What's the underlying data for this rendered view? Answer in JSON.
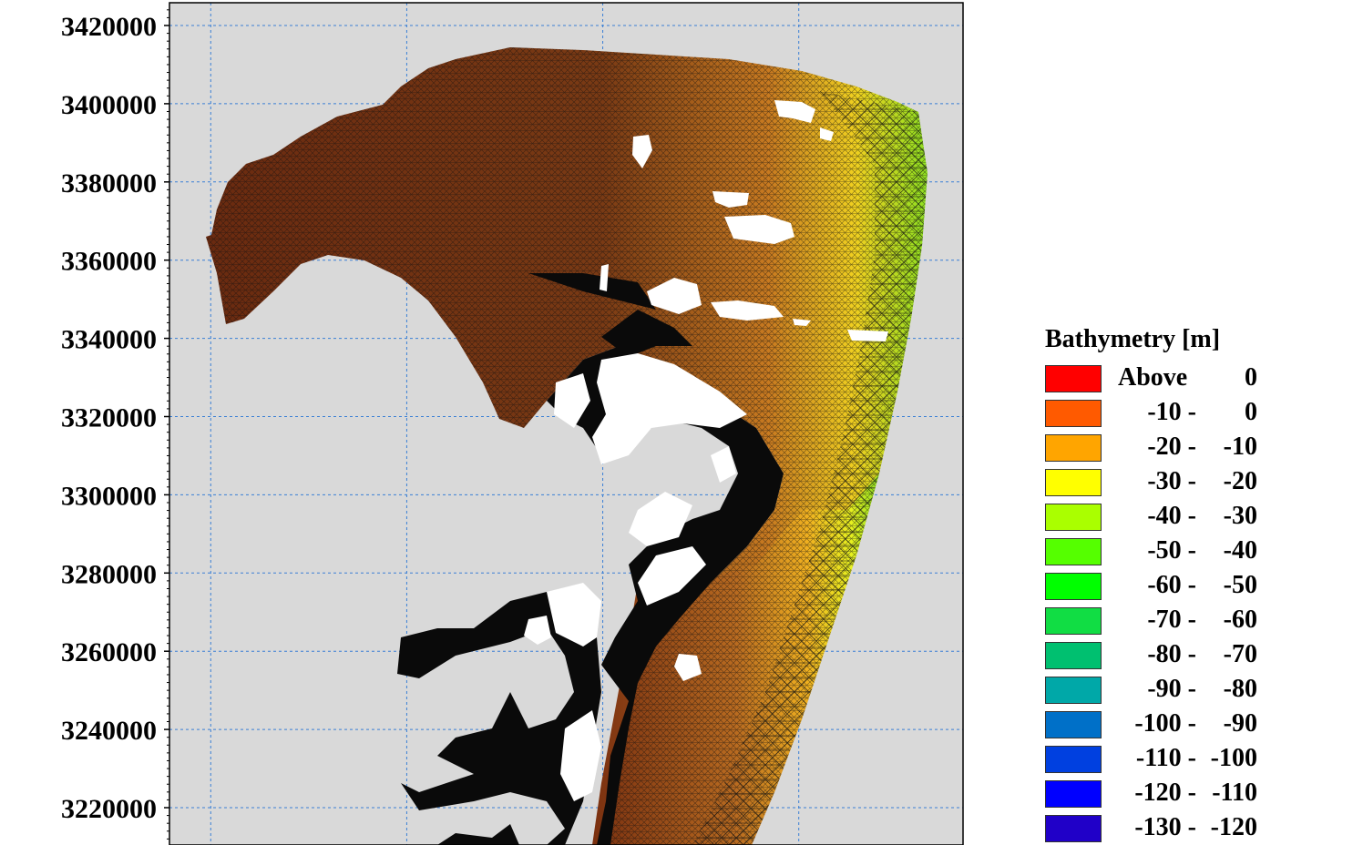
{
  "map": {
    "background_color": "#d9d9d9",
    "grid_color": "#3a7fd5",
    "mesh_line_color": "#111111",
    "land_color": "#ffffff",
    "y_range": [
      3208000,
      3426000
    ],
    "y_ticks": [
      {
        "value": 3420000,
        "label": "3420000"
      },
      {
        "value": 3400000,
        "label": "3400000"
      },
      {
        "value": 3380000,
        "label": "3380000"
      },
      {
        "value": 3360000,
        "label": "3360000"
      },
      {
        "value": 3340000,
        "label": "3340000"
      },
      {
        "value": 3320000,
        "label": "3320000"
      },
      {
        "value": 3300000,
        "label": "3300000"
      },
      {
        "value": 3280000,
        "label": "3280000"
      },
      {
        "value": 3260000,
        "label": "3260000"
      },
      {
        "value": 3240000,
        "label": "3240000"
      },
      {
        "value": 3220000,
        "label": "3220000"
      }
    ],
    "x_gridline_count": 4
  },
  "legend": {
    "title": "Bathymetry [m]",
    "items": [
      {
        "from": "Above",
        "to": "0",
        "color": "#ff0000"
      },
      {
        "from": "-10 -",
        "to": "0",
        "color": "#ff5a00"
      },
      {
        "from": "-20 -",
        "to": "-10",
        "color": "#ffa500"
      },
      {
        "from": "-30 -",
        "to": "-20",
        "color": "#ffff00"
      },
      {
        "from": "-40 -",
        "to": "-30",
        "color": "#aaff00"
      },
      {
        "from": "-50 -",
        "to": "-40",
        "color": "#55ff00"
      },
      {
        "from": "-60 -",
        "to": "-50",
        "color": "#00ff00"
      },
      {
        "from": "-70 -",
        "to": "-60",
        "color": "#11dd44"
      },
      {
        "from": "-80 -",
        "to": "-70",
        "color": "#00c070"
      },
      {
        "from": "-90 -",
        "to": "-80",
        "color": "#00a8a8"
      },
      {
        "from": "-100 -",
        "to": "-90",
        "color": "#0070c8"
      },
      {
        "from": "-110 -",
        "to": "-100",
        "color": "#0040e0"
      },
      {
        "from": "-120 -",
        "to": "-110",
        "color": "#0000ff"
      },
      {
        "from": "-130 -",
        "to": "-120",
        "color": "#2000c8"
      }
    ]
  }
}
